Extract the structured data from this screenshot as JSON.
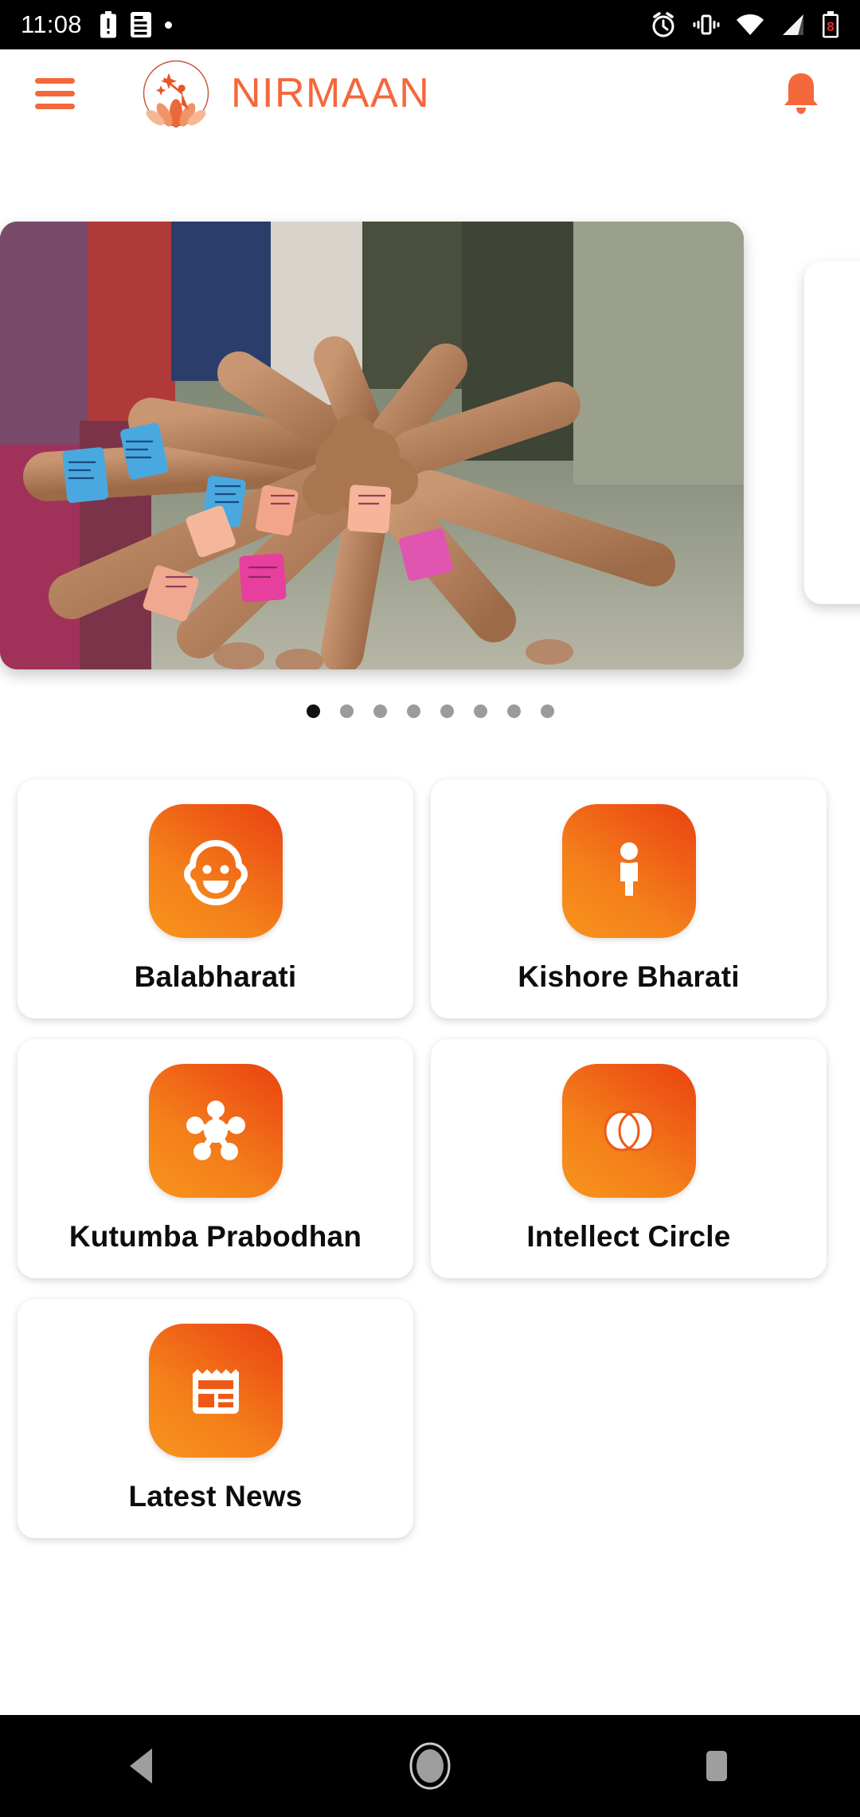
{
  "status_bar": {
    "time": "11:08",
    "left_icons": [
      "battery-alert-icon",
      "sim-card-icon",
      "dot-indicator"
    ],
    "right_icons": [
      "alarm-icon",
      "vibrate-icon",
      "wifi-icon",
      "signal-icon",
      "battery-low-icon"
    ],
    "battery_level_text": "8",
    "background_color": "#000000",
    "foreground_color": "#ffffff"
  },
  "app_bar": {
    "menu_icon": "hamburger-menu-icon",
    "logo_icon": "nirmaan-lotus-logo",
    "title": "NIRMAAN",
    "notification_icon": "bell-icon",
    "accent_color": "#F4683C",
    "background_color": "#ffffff"
  },
  "carousel": {
    "slide_alt": "children-hands-together-with-paper-wristbands",
    "active_index": 0,
    "total_slides": 8,
    "dots": [
      {
        "active": true
      },
      {
        "active": false
      },
      {
        "active": false
      },
      {
        "active": false
      },
      {
        "active": false
      },
      {
        "active": false
      },
      {
        "active": false
      },
      {
        "active": false
      }
    ]
  },
  "grid": {
    "tiles": [
      {
        "label": "Balabharati",
        "icon": "baby-face-icon"
      },
      {
        "label": "Kishore Bharati",
        "icon": "person-standing-icon"
      },
      {
        "label": "Kutumba Prabodhan",
        "icon": "molecule-network-icon"
      },
      {
        "label": "Intellect Circle",
        "icon": "overlapping-circles-icon"
      },
      {
        "label": "Latest News",
        "icon": "newspaper-icon"
      }
    ],
    "icon_gradient_from": "#F7941D",
    "icon_gradient_to": "#E8430F",
    "label_color": "#0d0d0d",
    "card_background": "#ffffff"
  },
  "nav_bar": {
    "buttons": [
      {
        "name": "back-button",
        "icon": "triangle-back-icon"
      },
      {
        "name": "home-button",
        "icon": "circle-home-icon"
      },
      {
        "name": "recents-button",
        "icon": "square-recents-icon"
      }
    ],
    "background_color": "#000000",
    "icon_color": "#9e9e9e"
  }
}
